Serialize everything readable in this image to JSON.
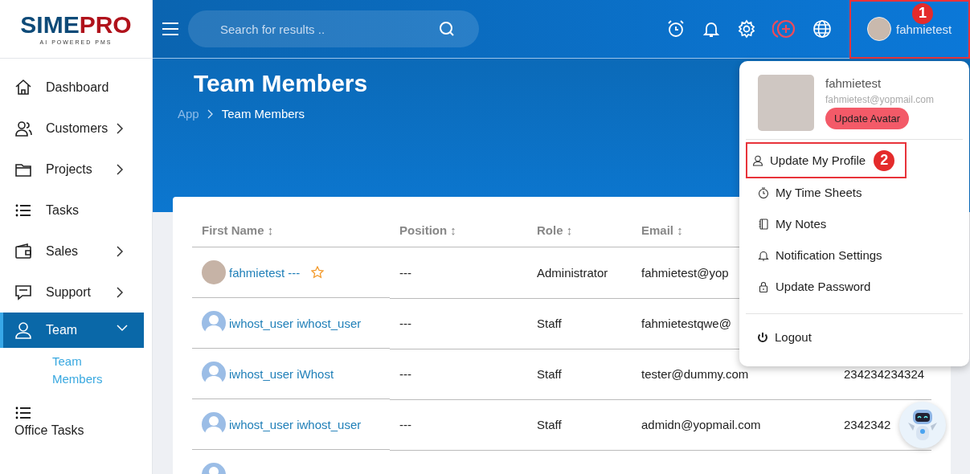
{
  "brand": {
    "name_first": "SIME",
    "name_second": "PRO",
    "tagline": "AI POWERED PMS"
  },
  "header": {
    "search": {
      "placeholder": "Search for results .."
    },
    "user": {
      "name": "fahmietest",
      "marker": "1"
    }
  },
  "sidebar": {
    "items": [
      {
        "label": "Dashboard",
        "expandable": false,
        "expanded": false,
        "selected": false
      },
      {
        "label": "Customers",
        "expandable": true,
        "expanded": false,
        "selected": false
      },
      {
        "label": "Projects",
        "expandable": true,
        "expanded": false,
        "selected": false
      },
      {
        "label": "Tasks",
        "expandable": false,
        "expanded": false,
        "selected": false
      },
      {
        "label": "Sales",
        "expandable": true,
        "expanded": false,
        "selected": false
      },
      {
        "label": "Support",
        "expandable": true,
        "expanded": false,
        "selected": false
      },
      {
        "label": "Team",
        "expandable": true,
        "expanded": true,
        "selected": true,
        "children": [
          {
            "label": "Team Members",
            "selected": true
          }
        ]
      },
      {
        "label": "Office Tasks",
        "expandable": false,
        "expanded": false,
        "selected": false
      }
    ]
  },
  "page": {
    "title": "Team Members",
    "breadcrumb": [
      "App",
      "Team Members"
    ]
  },
  "table": {
    "columns": [
      "First Name ↕",
      "Position ↕",
      "Role ↕",
      "Email ↕"
    ],
    "rows": [
      {
        "has_photo": true,
        "name": "fahmietest ---",
        "starred": true,
        "position": "---",
        "role": "Administrator",
        "email": "fahmietest@yop"
      },
      {
        "has_photo": false,
        "name": "iwhost_user iwhost_user",
        "starred": false,
        "position": "---",
        "role": "Staff",
        "email": "fahmietestqwe@"
      },
      {
        "has_photo": false,
        "name": "iwhost_user iWhost",
        "starred": false,
        "position": "---",
        "role": "Staff",
        "email": "tester@dummy.com",
        "column_5": "234234234324"
      },
      {
        "has_photo": false,
        "name": "iwhost_user iwhost_user",
        "starred": false,
        "position": "---",
        "role": "Staff",
        "email": "admidn@yopmail.com",
        "column_5": "2342342"
      },
      {
        "has_photo": false,
        "starred": false
      }
    ]
  },
  "user_menu": {
    "name": "fahmietest",
    "email": "fahmietest@yopmail.com",
    "avatar_button": "Update Avatar",
    "items": [
      {
        "label": "Update My Profile",
        "marker": "2"
      },
      {
        "label": "My Time Sheets"
      },
      {
        "label": "My Notes"
      },
      {
        "label": "Notification Settings"
      },
      {
        "label": "Update Password"
      }
    ],
    "logout": "Logout"
  }
}
